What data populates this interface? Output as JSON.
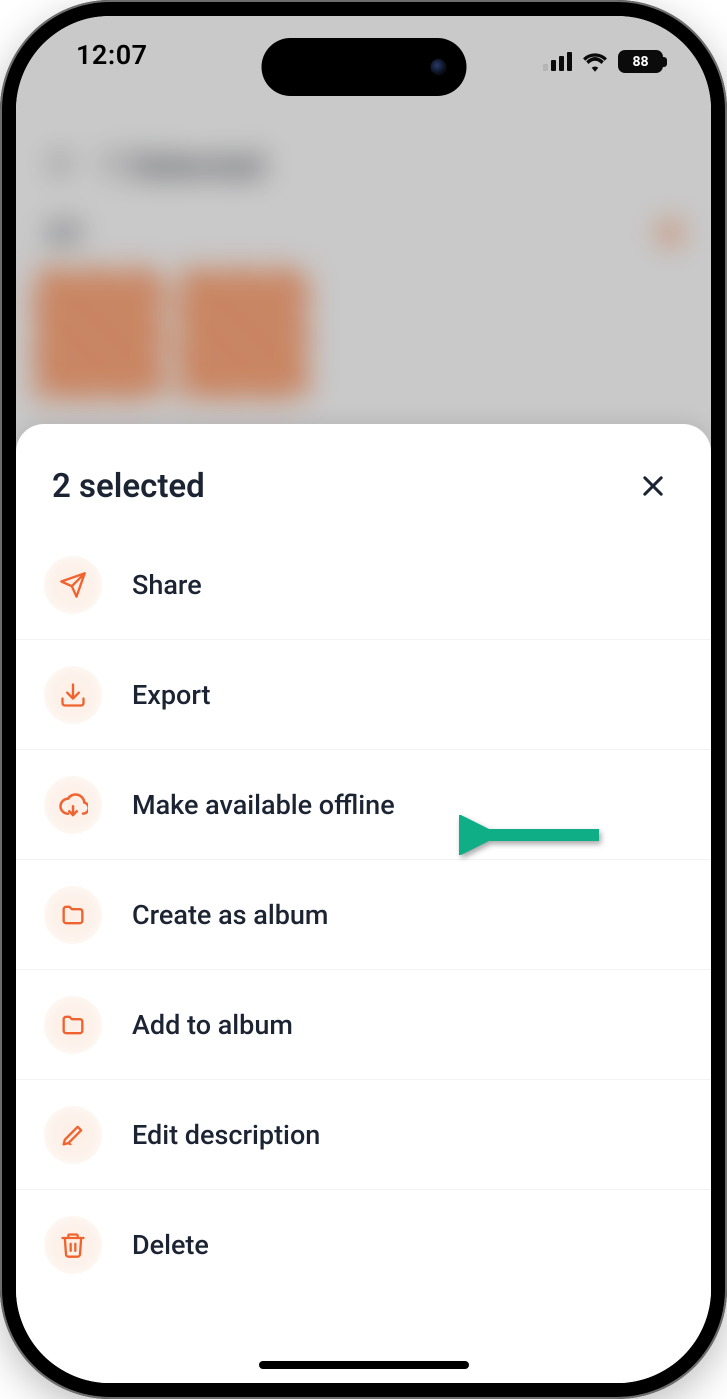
{
  "status_bar": {
    "time": "12:07",
    "battery_pct": "88"
  },
  "backdrop": {
    "header_title": "1 Selected",
    "section_label": "All"
  },
  "sheet": {
    "title": "2 selected",
    "items": [
      {
        "icon": "share-icon",
        "label": "Share"
      },
      {
        "icon": "export-icon",
        "label": "Export"
      },
      {
        "icon": "offline-icon",
        "label": "Make available offline"
      },
      {
        "icon": "album-create-icon",
        "label": "Create as album"
      },
      {
        "icon": "album-add-icon",
        "label": "Add to album"
      },
      {
        "icon": "edit-icon",
        "label": "Edit description"
      },
      {
        "icon": "trash-icon",
        "label": "Delete"
      }
    ]
  },
  "annotation": {
    "arrow_color": "#16a085",
    "points_to": "Make available offline"
  }
}
